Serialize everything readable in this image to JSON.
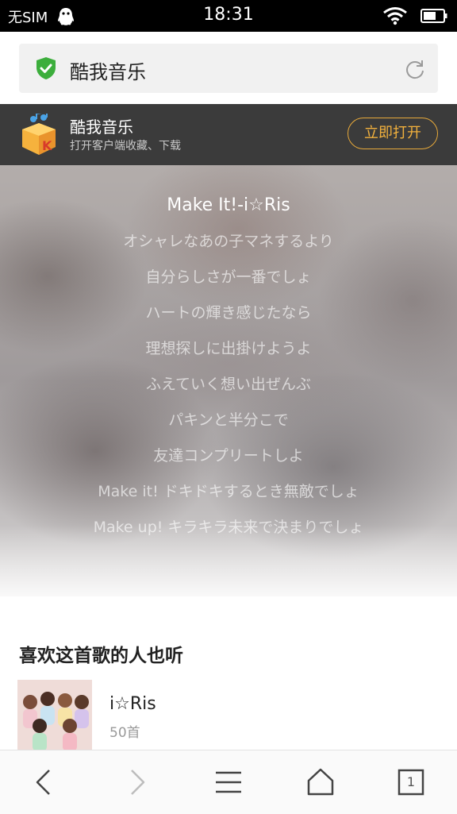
{
  "status_bar": {
    "carrier": "无SIM",
    "time": "18:31",
    "icons": [
      "qq-icon",
      "wifi-icon",
      "battery-icon"
    ]
  },
  "address_bar": {
    "title": "酷我音乐",
    "icons": [
      "shield-icon",
      "refresh-icon"
    ],
    "colors": {
      "shield": "#3cae3c",
      "background": "#f1f1f1"
    }
  },
  "app_banner": {
    "title": "酷我音乐",
    "subtitle": "打开客户端收藏、下载",
    "open_button_label": "立即打开",
    "colors": {
      "background": "#3b3b3b",
      "accent": "#f2b13d"
    }
  },
  "lyrics": {
    "title": "Make It!-i☆Ris",
    "lines": [
      "オシャレなあの子マネするより",
      "自分らしさが一番でしょ",
      "ハートの輝き感じたなら",
      "理想探しに出掛けようよ",
      "ふえていく想い出ぜんぶ",
      "パキンと半分こで",
      "友達コンプリートしよ",
      "Make it! ドキドキするとき無敵でしょ",
      "Make up! キラキラ未来で決まりでしょ"
    ]
  },
  "similar": {
    "section_title": "喜欢这首歌的人也听",
    "items": [
      {
        "name": "i☆Ris",
        "count": "50首"
      }
    ]
  },
  "toolbar": {
    "icons": [
      "back-icon",
      "forward-icon",
      "menu-icon",
      "home-icon",
      "tabs-icon"
    ],
    "tab_count": "1"
  }
}
